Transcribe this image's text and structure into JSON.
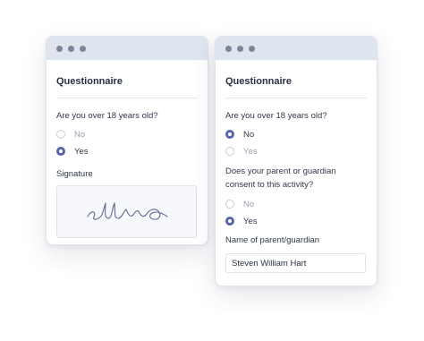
{
  "left_window": {
    "title": "Questionnaire",
    "question_age": "Are you over 18 years old?",
    "options": [
      {
        "label": "No",
        "selected": false
      },
      {
        "label": "Yes",
        "selected": true
      }
    ],
    "signature_label": "Signature"
  },
  "right_window": {
    "title": "Questionnaire",
    "question_age": "Are you over 18 years old?",
    "age_options": [
      {
        "label": "No",
        "selected": true
      },
      {
        "label": "Yes",
        "selected": false
      }
    ],
    "question_consent": "Does your parent or guardian consent to this activity?",
    "consent_options": [
      {
        "label": "No",
        "selected": false
      },
      {
        "label": "Yes",
        "selected": true
      }
    ],
    "parent_name_label": "Name of parent/guardian",
    "parent_name_value": "Steven William Hart"
  },
  "colors": {
    "accent": "#5a63ad",
    "titlebar": "#dfe5ef",
    "window_dot": "#7c8598",
    "signature_ink": "#5d6b8f"
  },
  "icons": {
    "window_controls": "three-dots",
    "signature": "handwritten-signature"
  }
}
